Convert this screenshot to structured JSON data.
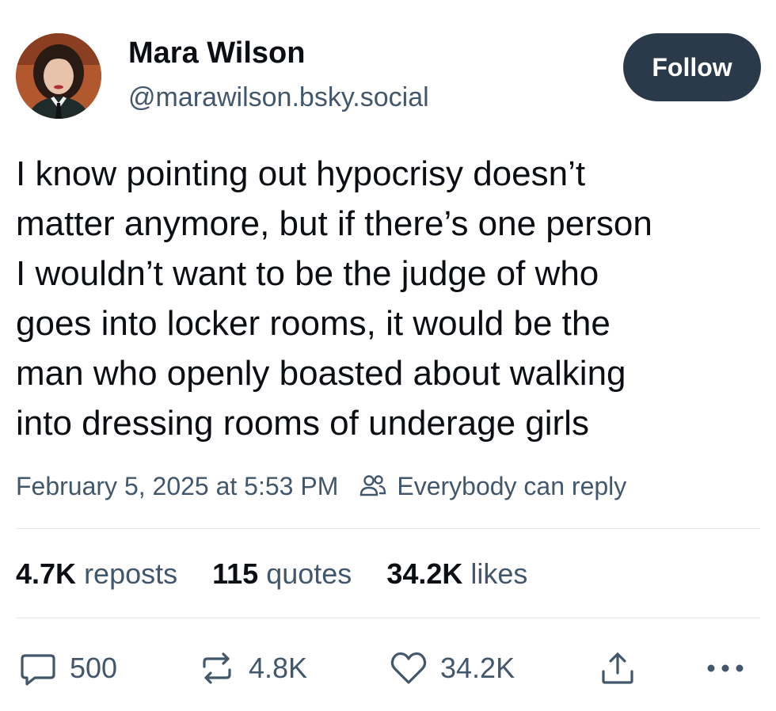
{
  "author": {
    "name": "Mara Wilson",
    "handle": "@marawilson.bsky.social"
  },
  "follow_label": "Follow",
  "post": {
    "text": "I know pointing out hypocrisy doesn’t\nmatter anymore, but if there’s one person\nI wouldn’t want to be the judge of who\ngoes into locker rooms, it would be the\nman who openly boasted about walking\ninto dressing rooms of underage girls",
    "timestamp": "February 5, 2025 at 5:53 PM",
    "reply_setting": "Everybody can reply"
  },
  "stats": {
    "reposts_count": "4.7K",
    "reposts_label": "reposts",
    "quotes_count": "115",
    "quotes_label": "quotes",
    "likes_count": "34.2K",
    "likes_label": "likes"
  },
  "actions": {
    "reply_count": "500",
    "repost_count": "4.8K",
    "like_count": "34.2K"
  },
  "colors": {
    "primary_text": "#0b0f14",
    "secondary_text": "#42576c",
    "follow_bg": "#2b3a4a",
    "divider": "#e3e8ed"
  },
  "icons": [
    "people-icon",
    "reply-bubble-icon",
    "repost-icon",
    "heart-icon",
    "share-icon",
    "more-icon"
  ]
}
